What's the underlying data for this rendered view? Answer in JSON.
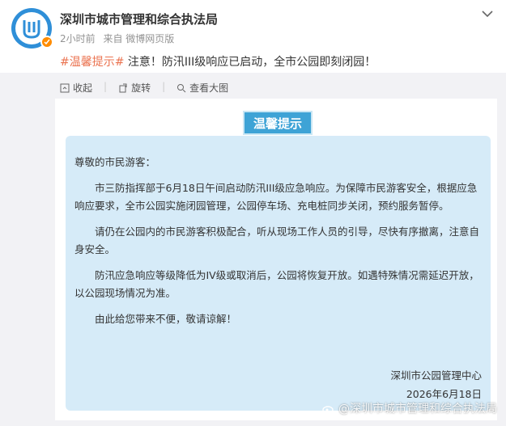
{
  "post": {
    "account_name": "深圳市城市管理和综合执法局",
    "time": "2小时前",
    "source": "来自 微博网页版",
    "hashtag": "#温馨提示#",
    "text": " 注意！防汛III级响应已启动，全市公园即刻闭园！"
  },
  "actions": {
    "collect": "收起",
    "rotate": "旋转",
    "view_large": "查看大图"
  },
  "notice": {
    "title": "温馨提示",
    "greeting": "尊敬的市民游客：",
    "paragraphs": [
      "市三防指挥部于6月18日午间启动防汛III级应急响应。为保障市民游客安全，根据应急响应要求，全市公园实施闭园管理，公园停车场、充电桩同步关闭，预约服务暂停。",
      "请仍在公园内的市民游客积极配合，听从现场工作人员的引导，尽快有序撤离，注意自身安全。",
      "防汛应急响应等级降低为IV级或取消后，公园将恢复开放。如遇特殊情况需延迟开放，以公园现场情况为准。",
      "由此给您带来不便，敬请谅解！"
    ],
    "signer": "深圳市公园管理中心",
    "date": "2026年6月18日"
  },
  "watermark": "@深圳市城市管理和综合执法局",
  "colors": {
    "hashtag": "#eb7350",
    "badge": "#3ea3d6",
    "notice_bg": "#d6ebf8",
    "verify": "#ff8c00"
  }
}
